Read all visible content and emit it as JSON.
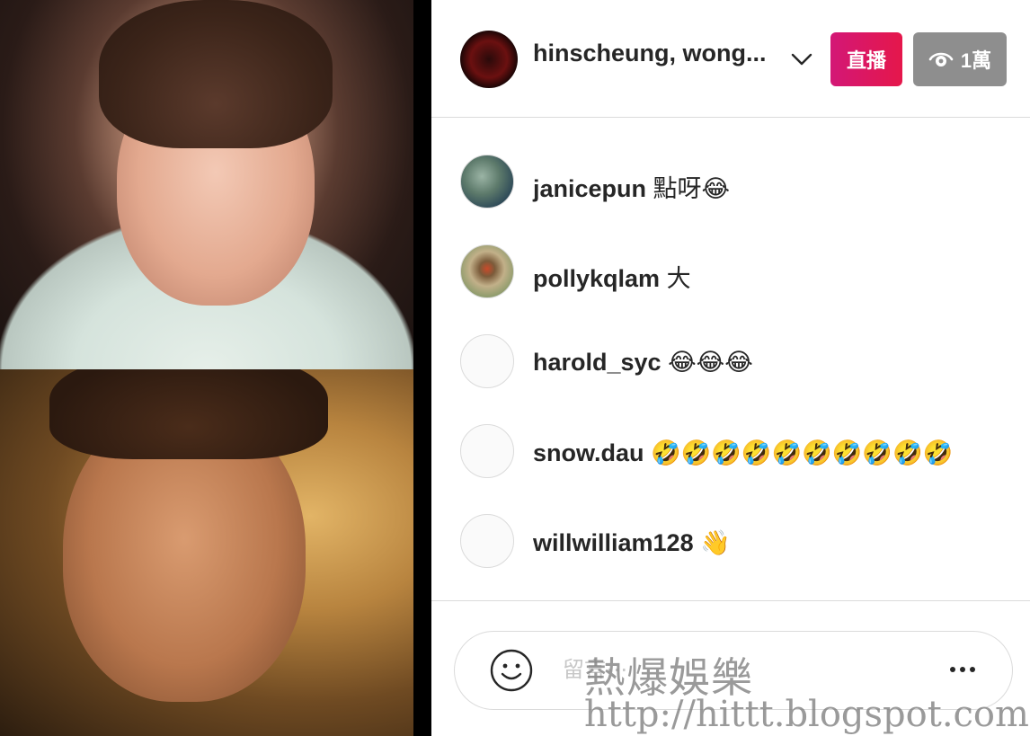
{
  "header": {
    "host_name": "hinscheung, wong...",
    "live_label": "直播",
    "viewer_count": "1萬"
  },
  "comments": [
    {
      "user": "janicepun",
      "text": "點呀😂"
    },
    {
      "user": "pollykqlam",
      "text": "大"
    },
    {
      "user": "harold_syc",
      "text": "😂😂😂"
    },
    {
      "user": "snow.dau",
      "text": "🤣🤣🤣🤣🤣🤣🤣🤣🤣🤣"
    },
    {
      "user": "willwilliam128",
      "text": "👋"
    }
  ],
  "comment_box": {
    "placeholder": "留言⋯"
  },
  "watermark": {
    "line1": "熱爆娛樂",
    "line2": "http://hittt.blogspot.com"
  },
  "colors": {
    "live_gradient_start": "#d31776",
    "live_gradient_end": "#e5174b",
    "viewer_badge": "#8e8e8e",
    "text": "#262626",
    "border": "#dbdbdb"
  },
  "icons": [
    "chevron-down-icon",
    "eye-icon",
    "smiley-icon",
    "more-icon"
  ]
}
